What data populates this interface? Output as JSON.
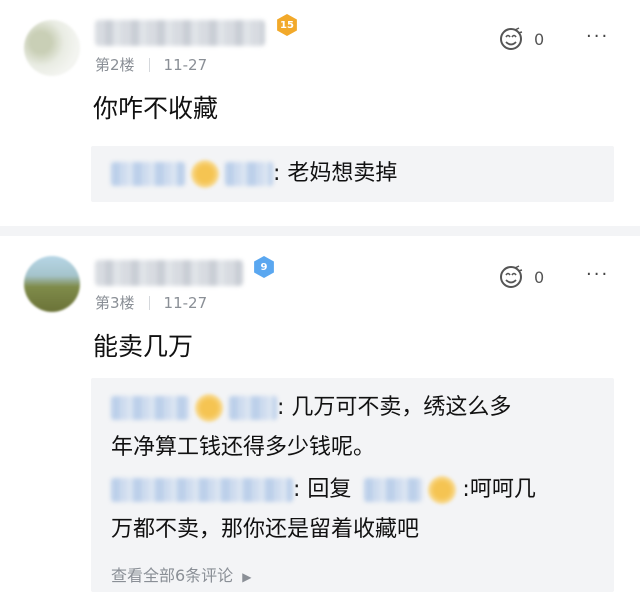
{
  "posts": [
    {
      "badge": "15",
      "floor": "第2楼",
      "date": "11-27",
      "likes": "0",
      "more": "···",
      "content": "你咋不收藏",
      "replies": [
        {
          "text": "老妈想卖掉"
        }
      ]
    },
    {
      "badge": "9",
      "floor": "第3楼",
      "date": "11-27",
      "likes": "0",
      "more": "···",
      "content": "能卖几万",
      "replies": [
        {
          "text_line1": "几万可不卖，绣这么多",
          "text_line2": "年净算工钱还得多少钱呢。"
        },
        {
          "prefix": "回复",
          "text_line1": ":呵呵几",
          "text_line2": "万都不卖，那你还是留着收藏吧"
        }
      ],
      "view_all": "查看全部6条评论"
    }
  ],
  "colors": {
    "badge_gold": "#f2a92a",
    "badge_blue": "#5aa7f0",
    "reply_bg": "#f3f4f6"
  },
  "icons": {
    "like": "like-face-icon",
    "more": "more-dots-icon",
    "arrow": "chevron-right-icon"
  }
}
